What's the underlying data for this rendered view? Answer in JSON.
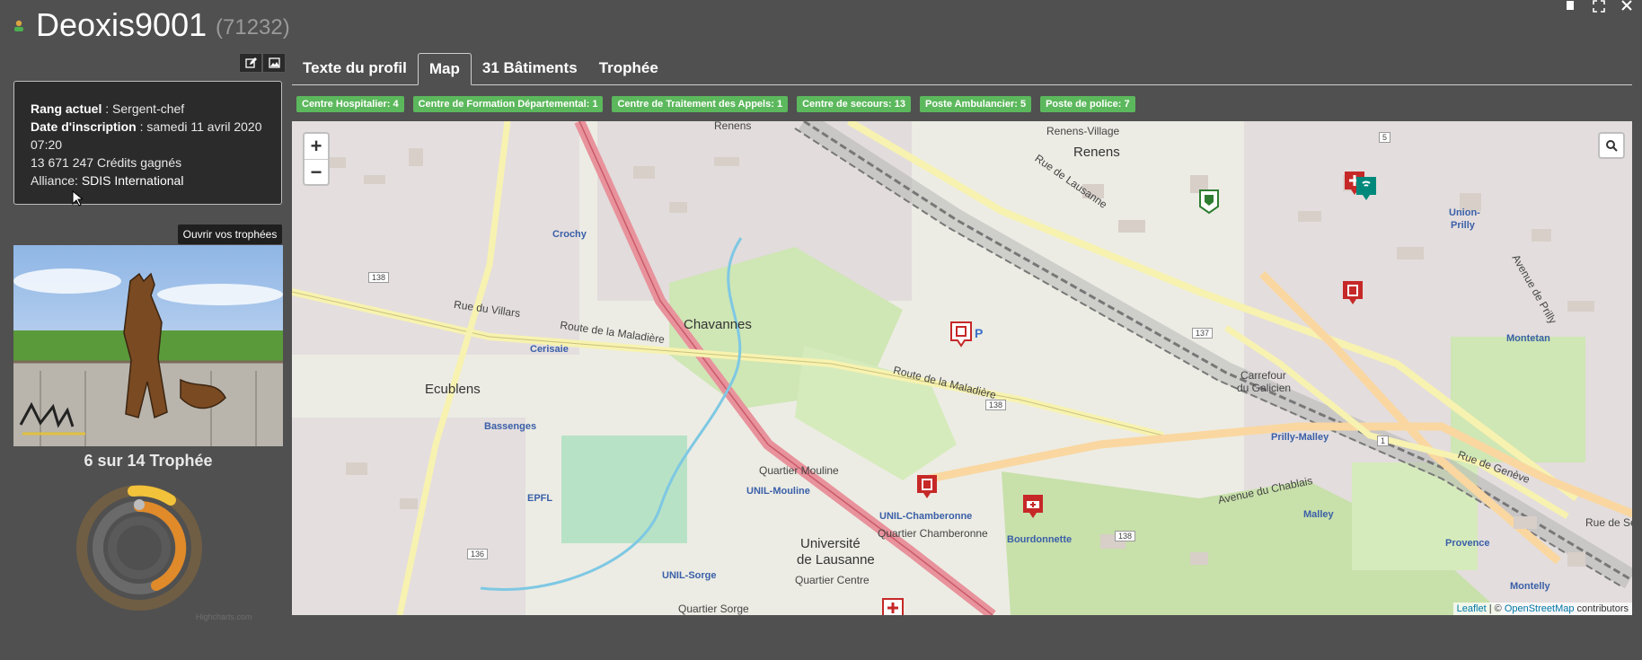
{
  "header": {
    "username": "Deoxis9001",
    "user_id": "(71232)"
  },
  "window_controls": [
    "minimize",
    "maximize",
    "close"
  ],
  "profile": {
    "rank_label": "Rang actuel",
    "rank_value": " : Sergent-chef",
    "registration_label": "Date d'inscription",
    "registration_value": " : samedi 11 avril 2020 07:20",
    "credits": "13 671 247 Crédits gagnés",
    "alliance_label": "Alliance: ",
    "alliance_value": "SDIS International"
  },
  "trophies": {
    "open_button": "Ouvrir vos trophées",
    "count_text": "6 sur 14 Trophée",
    "chart_credit": "Highcharts.com"
  },
  "tabs": [
    {
      "label": "Texte du profil",
      "active": false
    },
    {
      "label": "Map",
      "active": true
    },
    {
      "label": "31 Bâtiments",
      "active": false
    },
    {
      "label": "Trophée",
      "active": false
    }
  ],
  "badges": [
    "Centre Hospitalier: 4",
    "Centre de Formation Départemental: 1",
    "Centre de Traitement des Appels: 1",
    "Centre de secours: 13",
    "Poste Ambulancier: 5",
    "Poste de police: 7"
  ],
  "map": {
    "zoom_in": "+",
    "zoom_out": "−",
    "attribution_leaflet": "Leaflet",
    "attribution_sep": " | © ",
    "attribution_osm": "OpenStreetMap",
    "attribution_tail": " contributors",
    "labels": {
      "renens_top": "Renens",
      "renens": "Renens",
      "renens_village": "Renens-Village",
      "crochy": "Crochy",
      "chavannes": "Chavannes",
      "cerisaie": "Cerisaie",
      "ecublens": "Ecublens",
      "bassenges": "Bassenges",
      "epfl": "EPFL",
      "unil_sorge": "UNIL-Sorge",
      "unil_mouline": "UNIL-Mouline",
      "quartier_mouline": "Quartier Mouline",
      "unil_chamberonne": "UNIL-Chamberonne",
      "quartier_chamberonne": "Quartier Chamberonne",
      "universite": "Université",
      "de_lausanne": "de Lausanne",
      "quartier_centre": "Quartier Centre",
      "quartier_sorge": "Quartier Sorge",
      "bourdonnette": "Bourdonnette",
      "carrefour": "Carrefour",
      "du_galicien": "du Galicien",
      "prilly_malley": "Prilly-Malley",
      "malley": "Malley",
      "union_prilly": "Union-",
      "prilly": "Prilly",
      "montetan": "Montetan",
      "provence": "Provence",
      "montelly": "Montelly",
      "rue_de_lausanne": "Rue de Lausanne",
      "rue_du_villars": "Rue du Villars",
      "route_maladiere": "Route de la Maladière",
      "route_maladiere2": "Route de la Maladière",
      "avenue_chablais": "Avenue du Chablais",
      "rue_de_geneve": "Rue de Genève",
      "avenue_de_prilly": "Avenue de Prilly",
      "rue_de_sebeillon": "Rue de Sébe",
      "route_138a": "138",
      "route_138b": "138",
      "route_138c": "138",
      "route_136": "136",
      "route_137": "137",
      "route_1": "1",
      "route_5": "5",
      "parking": "P"
    },
    "markers": [
      {
        "kind": "fire-station",
        "color": "#2e7d32"
      },
      {
        "kind": "hospital",
        "color": "#c62828"
      },
      {
        "kind": "police",
        "color": "#c62828"
      },
      {
        "kind": "training-center",
        "color": "#c62828"
      },
      {
        "kind": "dispatch-center",
        "color": "#00897b"
      },
      {
        "kind": "police",
        "color": "#c62828"
      },
      {
        "kind": "ambulance",
        "color": "#c62828"
      },
      {
        "kind": "hospital",
        "color": "#c62828"
      }
    ]
  },
  "colors": {
    "background": "#505050",
    "badge": "#5cb85c",
    "map_base": "#ecece4",
    "marker_red": "#c62828"
  }
}
